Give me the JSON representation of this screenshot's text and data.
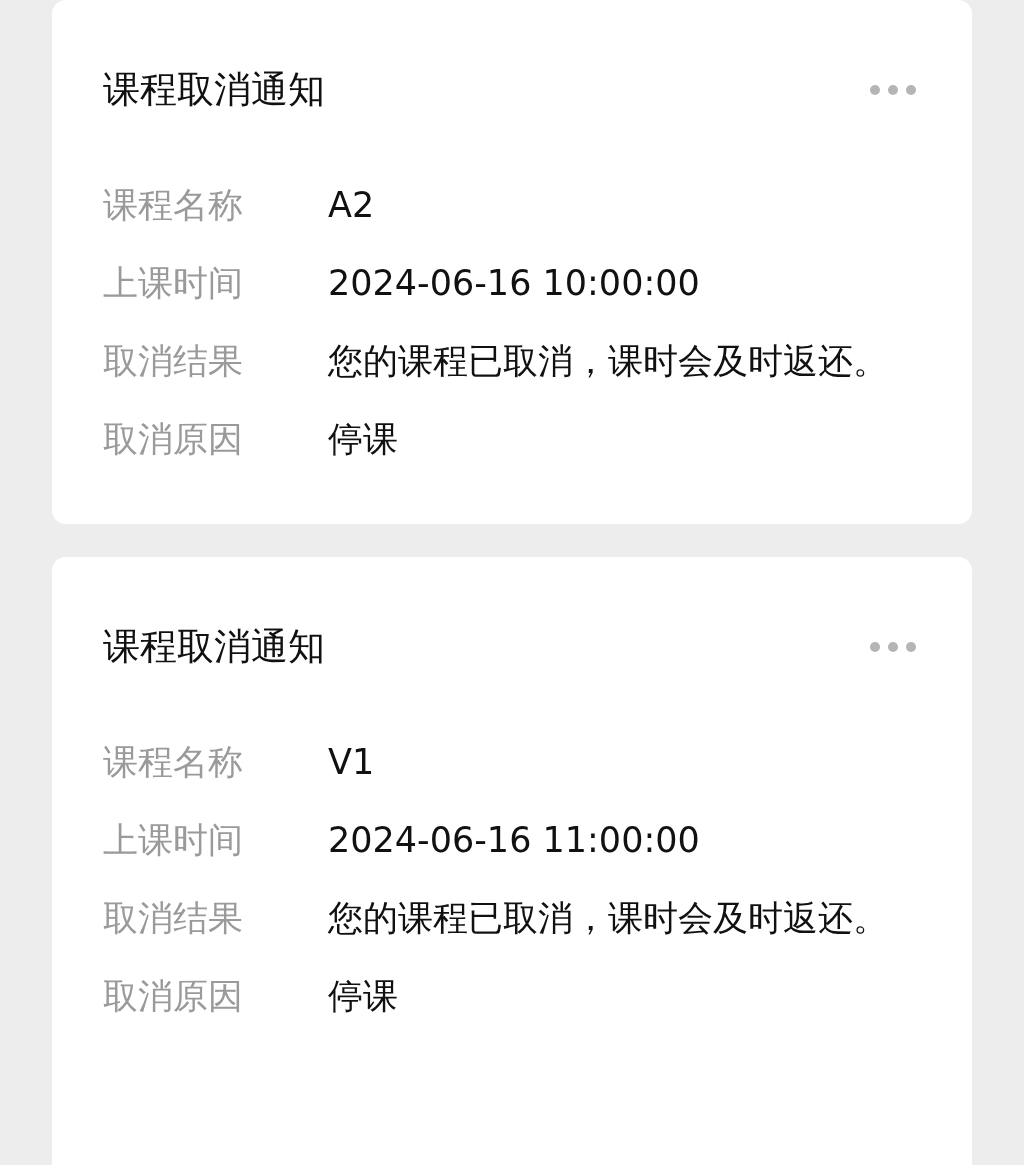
{
  "cards": [
    {
      "title": "课程取消通知",
      "rows": [
        {
          "label": "课程名称",
          "value": "A2"
        },
        {
          "label": "上课时间",
          "value": "2024-06-16 10:00:00"
        },
        {
          "label": "取消结果",
          "value": "您的课程已取消，课时会及时返还。"
        },
        {
          "label": "取消原因",
          "value": "停课"
        }
      ]
    },
    {
      "title": "课程取消通知",
      "rows": [
        {
          "label": "课程名称",
          "value": "V1"
        },
        {
          "label": "上课时间",
          "value": "2024-06-16 11:00:00"
        },
        {
          "label": "取消结果",
          "value": "您的课程已取消，课时会及时返还。"
        },
        {
          "label": "取消原因",
          "value": "停课"
        }
      ]
    }
  ]
}
